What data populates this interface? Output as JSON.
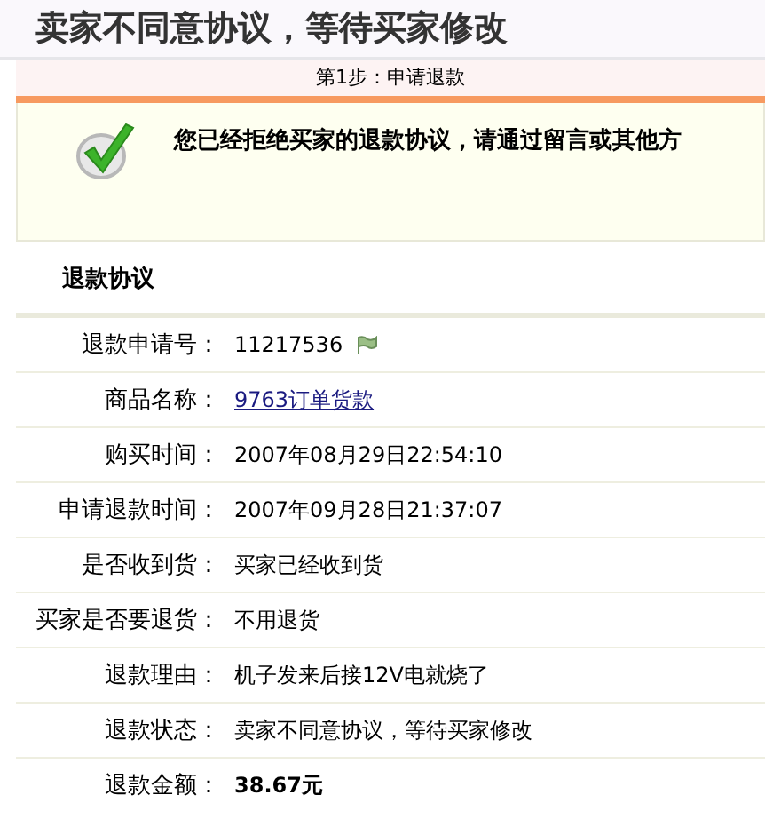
{
  "page_title": "卖家不同意协议，等待买家修改",
  "step": {
    "label": "第1步：申请退款"
  },
  "notice": {
    "message": "您已经拒绝买家的退款协议，请通过留言或其他方"
  },
  "section_title": "退款协议",
  "rows": [
    {
      "label": "退款申请号：",
      "value": "11217536",
      "kind": "flagged"
    },
    {
      "label": "商品名称：",
      "value": "9763订单货款",
      "kind": "link"
    },
    {
      "label": "购买时间：",
      "value": "2007年08月29日22:54:10",
      "kind": "text"
    },
    {
      "label": "申请退款时间：",
      "value": "2007年09月28日21:37:07",
      "kind": "text"
    },
    {
      "label": "是否收到货：",
      "value": "买家已经收到货",
      "kind": "text"
    },
    {
      "label": "买家是否要退货：",
      "value": "不用退货",
      "kind": "text"
    },
    {
      "label": "退款理由：",
      "value": "机子发来后接12V电就烧了",
      "kind": "text"
    },
    {
      "label": "退款状态：",
      "value": "卖家不同意协议，等待买家修改",
      "kind": "text"
    },
    {
      "label": "退款金额：",
      "value": "38.67元",
      "kind": "amount"
    }
  ]
}
